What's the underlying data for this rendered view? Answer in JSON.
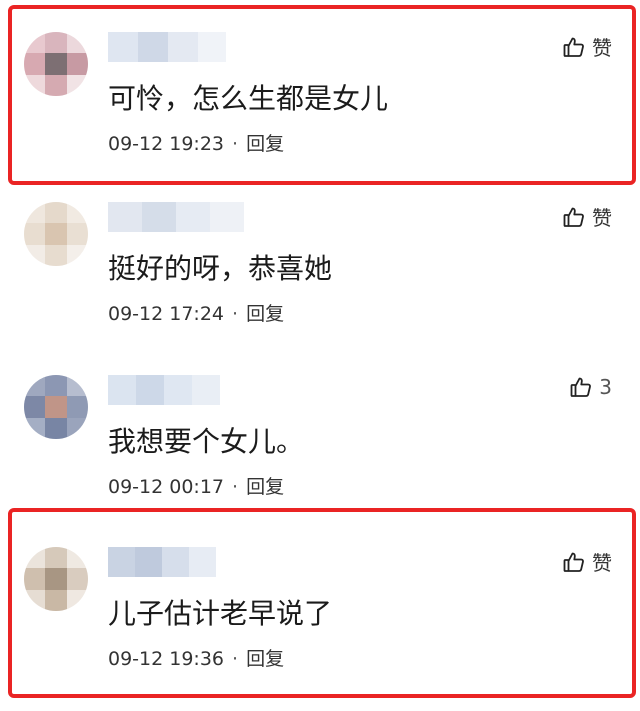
{
  "comments": [
    {
      "text": "可怜，怎么生都是女儿",
      "time": "09-12 19:23",
      "reply": "回复",
      "likes": "赞"
    },
    {
      "text": "挺好的呀，恭喜她",
      "time": "09-12 17:24",
      "reply": "回复",
      "likes": "赞"
    },
    {
      "text": "我想要个女儿。",
      "time": "09-12 00:17",
      "reply": "回复",
      "likes": "3"
    },
    {
      "text": "儿子估计老早说了",
      "time": "09-12 19:36",
      "reply": "回复",
      "likes": "赞"
    }
  ],
  "separator": "·",
  "highlight_color": "#ea2424"
}
